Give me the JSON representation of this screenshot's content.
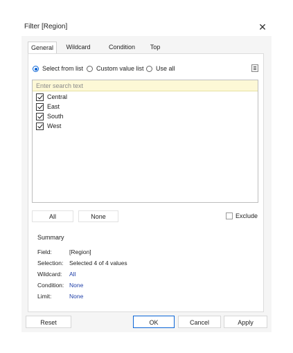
{
  "window": {
    "title": "Filter [Region]",
    "close_glyph": "✕"
  },
  "tabs": [
    {
      "label": "General",
      "active": true
    },
    {
      "label": "Wildcard",
      "active": false
    },
    {
      "label": "Condition",
      "active": false
    },
    {
      "label": "Top",
      "active": false
    }
  ],
  "mode": {
    "options": [
      {
        "label": "Select from list",
        "selected": true
      },
      {
        "label": "Custom value list",
        "selected": false
      },
      {
        "label": "Use all",
        "selected": false
      }
    ],
    "menu_icon": "list-menu-icon"
  },
  "search": {
    "placeholder": "Enter search text",
    "value": ""
  },
  "values": [
    {
      "label": "Central",
      "checked": true
    },
    {
      "label": "East",
      "checked": true
    },
    {
      "label": "South",
      "checked": true
    },
    {
      "label": "West",
      "checked": true
    }
  ],
  "list_buttons": {
    "all_label": "All",
    "none_label": "None"
  },
  "exclude": {
    "label": "Exclude",
    "checked": false
  },
  "summary": {
    "heading": "Summary",
    "rows": [
      {
        "key": "Field:",
        "value": "[Region]"
      },
      {
        "key": "Selection:",
        "value": "Selected 4 of 4 values"
      },
      {
        "key": "Wildcard:",
        "value": "All"
      },
      {
        "key": "Condition:",
        "value": "None"
      },
      {
        "key": "Limit:",
        "value": "None"
      }
    ]
  },
  "footer": {
    "reset_label": "Reset",
    "ok_label": "OK",
    "cancel_label": "Cancel",
    "apply_label": "Apply"
  },
  "colors": {
    "accent": "#0a64d6",
    "link": "#1f3fa8",
    "search_bg": "#fdf8d6"
  }
}
